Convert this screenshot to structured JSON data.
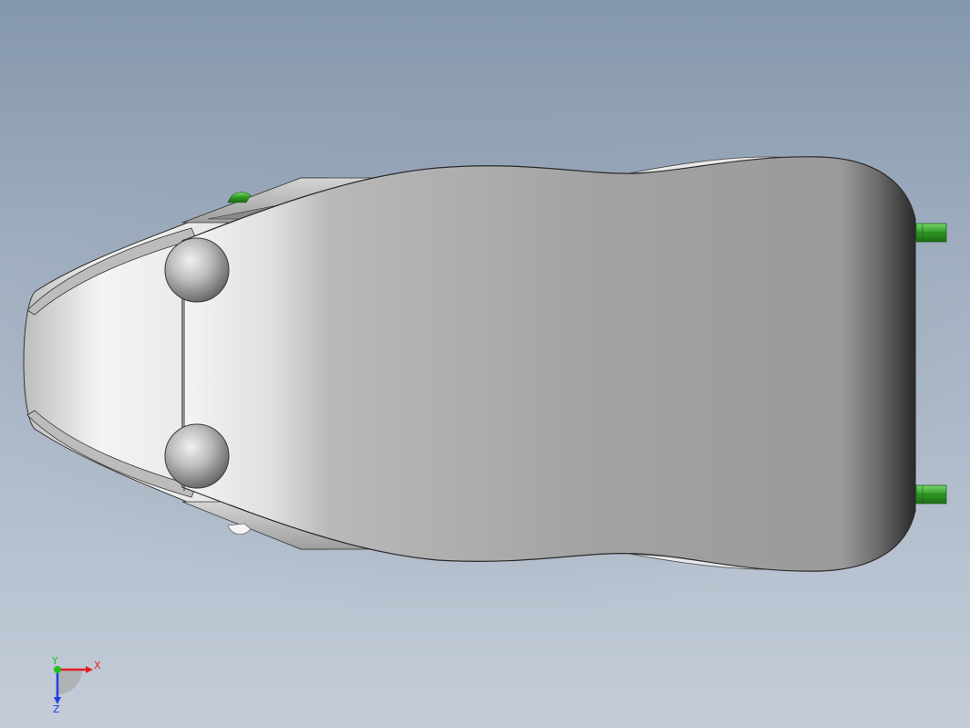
{
  "viewport": {
    "background_top": "#8597ad",
    "background_bottom": "#c4ccd8"
  },
  "model": {
    "body_color": "#a2a2a2",
    "highlight_color": "#f2f2f2",
    "shadow_color": "#303030",
    "pin_color": "#36a32a"
  },
  "triad": {
    "x_label": "X",
    "y_label": "Y",
    "z_label": "Z",
    "x_color": "#e02020",
    "y_color": "#20c020",
    "z_color": "#2040e0"
  }
}
